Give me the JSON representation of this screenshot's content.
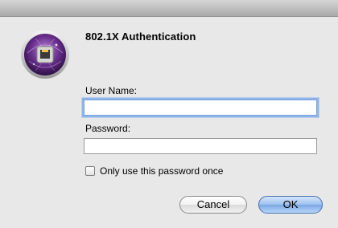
{
  "dialog": {
    "heading": "802.1X Authentication",
    "icon": "network-lock-icon"
  },
  "form": {
    "username_label": "User Name:",
    "username_value": "",
    "password_label": "Password:",
    "password_value": "",
    "once_checkbox_label": "Only use this password once",
    "once_checked": false
  },
  "buttons": {
    "cancel": "Cancel",
    "ok": "OK"
  },
  "colors": {
    "icon_purple": "#6a2f8e",
    "focus_ring": "#8fb4e8",
    "default_button": "#7aa7e4"
  }
}
